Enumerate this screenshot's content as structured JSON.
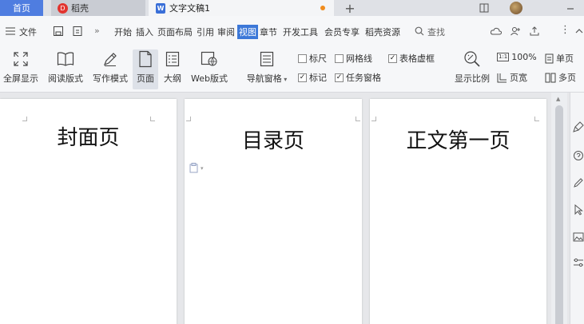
{
  "tabs": {
    "home": "首页",
    "daoke": "稻壳",
    "doc": "文字文稿1",
    "add": "+"
  },
  "menu": {
    "file": "文件",
    "more": "»",
    "items": [
      "开始",
      "插入",
      "页面布局",
      "引用",
      "审阅",
      "视图",
      "章节",
      "开发工具",
      "会员专享",
      "稻壳资源"
    ],
    "active_index": 5,
    "search": "查找",
    "kebab": "⋮"
  },
  "ribbon": {
    "fullscreen": "全屏显示",
    "reading": "阅读版式",
    "writing": "写作模式",
    "page": "页面",
    "outline": "大纲",
    "web": "Web版式",
    "navpane": "导航窗格",
    "ruler": "标尺",
    "gridlines": "网格线",
    "tablegrid": "表格虚框",
    "marks": "标记",
    "taskpane": "任务窗格",
    "zoom_label": "显示比例",
    "zoom_100": "100%",
    "single": "单页",
    "pagewidth": "页宽",
    "multi": "多页"
  },
  "checks": {
    "ruler": false,
    "gridlines": false,
    "tablegrid": true,
    "marks": true,
    "taskpane": true
  },
  "pages": [
    {
      "title": "封面页"
    },
    {
      "title": "目录页"
    },
    {
      "title": "正文第一页"
    }
  ],
  "colors": {
    "accent": "#3c78d8",
    "home_tab": "#4f7de0",
    "modified_dot": "#f08c1e"
  }
}
